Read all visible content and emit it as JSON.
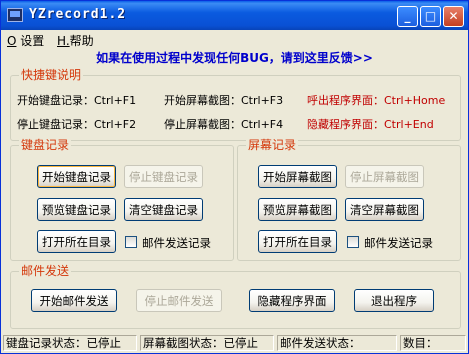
{
  "window": {
    "title": "YZrecord1.2",
    "min_glyph": "_",
    "max_glyph": "□",
    "close_glyph": "✕"
  },
  "menu": [
    {
      "key": "O",
      "label": "设置"
    },
    {
      "key": "H.",
      "label": "帮助"
    }
  ],
  "banner": "如果在使用过程中发现任何BUG，请到这里反馈>>",
  "shortcuts": {
    "legend": "快捷键说明",
    "start_kb": "开始键盘记录：Ctrl+F1",
    "stop_kb": "停止键盘记录：Ctrl+F2",
    "start_screen": "开始屏幕截图：Ctrl+F3",
    "stop_screen": "停止屏幕截图：Ctrl+F4",
    "show_ui": "呼出程序界面：Ctrl+Home",
    "hide_ui": "隐藏程序界面：Ctrl+End"
  },
  "keyboard": {
    "legend": "键盘记录",
    "start": "开始键盘记录",
    "stop": "停止键盘记录",
    "preview": "预览键盘记录",
    "clear": "清空键盘记录",
    "open_dir": "打开所在目录",
    "email": "邮件发送记录"
  },
  "screen": {
    "legend": "屏幕记录",
    "start": "开始屏幕截图",
    "stop": "停止屏幕截图",
    "preview": "预览屏幕截图",
    "clear": "清空屏幕截图",
    "open_dir": "打开所在目录",
    "email": "邮件发送记录"
  },
  "mail": {
    "legend": "邮件发送",
    "start": "开始邮件发送",
    "stop": "停止邮件发送",
    "hide": "隐藏程序界面",
    "exit": "退出程序"
  },
  "status": {
    "kb": "键盘记录状态：已停止",
    "screen": "屏幕截图状态：已停止",
    "mail": "邮件发送状态：",
    "count": "数目："
  },
  "colors": {
    "accent_red": "#d4380b",
    "banner_blue": "#0000cc",
    "title_blue": "#0a5ee8"
  }
}
